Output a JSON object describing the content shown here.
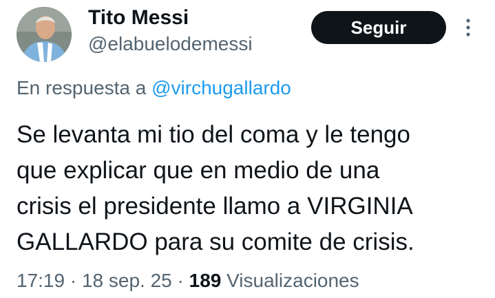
{
  "author": {
    "display_name": "Tito Messi",
    "handle": "@elabuelodemessi"
  },
  "follow_button": {
    "label": "Seguir"
  },
  "more_menu": {
    "icon": "more-vertical-icon"
  },
  "reply_context": {
    "prefix": "En respuesta a",
    "mention": "@virchugallardo"
  },
  "tweet": {
    "text_lines": [
      "Se levanta mi tio del coma y le tengo",
      "que explicar que en medio de una",
      "crisis el presidente llamo a VIRGINIA",
      "GALLARDO para su comite de crisis."
    ]
  },
  "meta": {
    "time": "17:19",
    "separator": "·",
    "date": "18 sep. 25",
    "views_count": "189",
    "views_label": "Visualizaciones"
  },
  "colors": {
    "text": "#0f1419",
    "secondary": "#536471",
    "link": "#1d9bf0",
    "button_bg": "#0f1419",
    "button_text": "#ffffff"
  }
}
